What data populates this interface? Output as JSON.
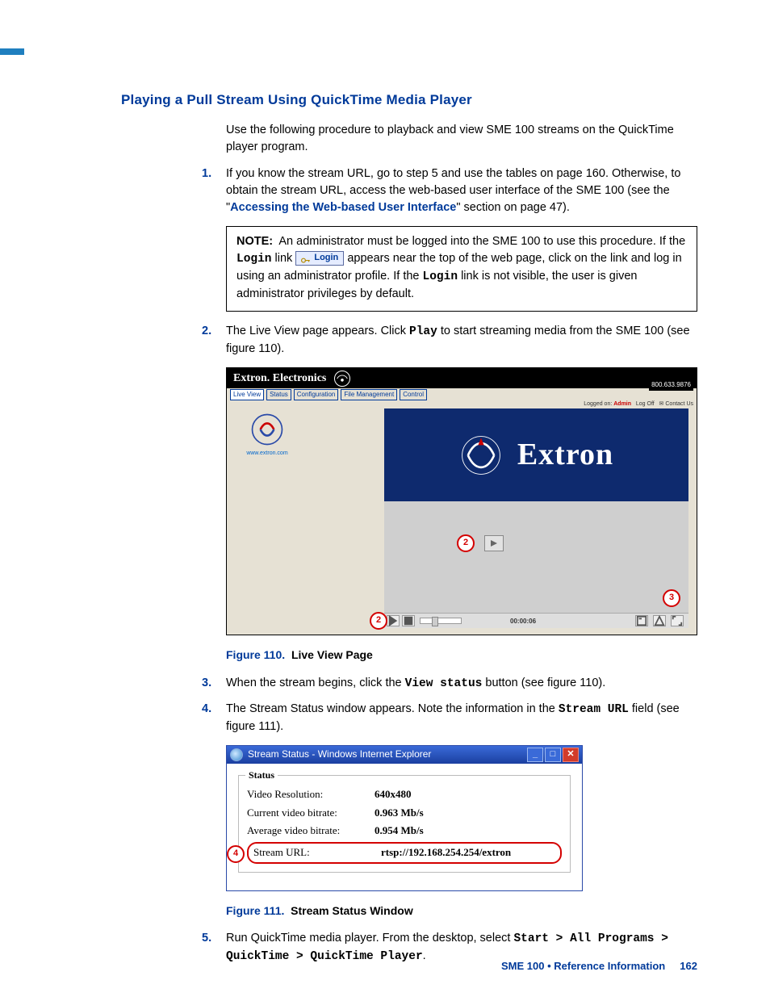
{
  "heading": "Playing a Pull Stream Using QuickTime Media Player",
  "intro": "Use the following procedure to playback and view SME 100 streams on the QuickTime player program.",
  "steps": [
    {
      "num": "1.",
      "pre": "If you know the stream URL, go to step 5 and use the tables on page 160. Otherwise, to obtain the stream URL, access the web-based user interface of the SME 100 (see the ",
      "link": "Accessing the Web-based User Interface",
      "post": " section on page 47)."
    },
    {
      "num": "2.",
      "pre": "The Live View page appears. Click ",
      "code": "Play",
      "post": " to start streaming media from the SME 100 (see figure 110)."
    },
    {
      "num": "3.",
      "pre": "When the stream begins, click the ",
      "code": "View status",
      "post": " button (see figure 110)."
    },
    {
      "num": "4.",
      "pre": "The Stream Status window appears. Note the information in the ",
      "code": "Stream URL",
      "post": " field (see figure 111)."
    },
    {
      "num": "5.",
      "pre": "Run QuickTime media player. From the desktop, select ",
      "code": "Start > All Programs > QuickTime > QuickTime Player"
    }
  ],
  "note": {
    "label": "NOTE:",
    "line1": "An administrator must be logged into the SME 100 to use this procedure.",
    "login_word": "Login",
    "chip": "Login",
    "line2": " appears near the top of the web page, click on the link and log in using an administrator profile. If the ",
    "line3": " link is not visible, the user is given administrator privileges by default."
  },
  "fig110": {
    "brand": "Extron. Electronics",
    "phone": "800.633.9876",
    "tabs": [
      "Live View",
      "Status",
      "Configuration",
      "File Management",
      "Control"
    ],
    "contact": "",
    "logged_label": "Logged on:",
    "logged_user": "Admin",
    "logoff": "Log Off",
    "contact2": "Contact Us",
    "site": "www.extron.com",
    "video_text": "Extron",
    "time": "00:00:06",
    "callouts": [
      "2",
      "3",
      "2"
    ],
    "caption_num": "Figure 110.",
    "caption_title": "Live View Page"
  },
  "fig111": {
    "title": "Stream Status - Windows Internet Explorer",
    "legend": "Status",
    "rows": [
      {
        "k": "Video Resolution:",
        "v": "640x480"
      },
      {
        "k": "Current video bitrate:",
        "v": "0.963 Mb/s"
      },
      {
        "k": "Average video bitrate:",
        "v": "0.954 Mb/s"
      },
      {
        "k": "Stream URL:",
        "v": "rtsp://192.168.254.254/extron"
      }
    ],
    "callout": "4",
    "caption_num": "Figure 111.",
    "caption_title": "Stream Status Window"
  },
  "footer": {
    "title": "SME 100 • Reference Information",
    "page": "162"
  }
}
